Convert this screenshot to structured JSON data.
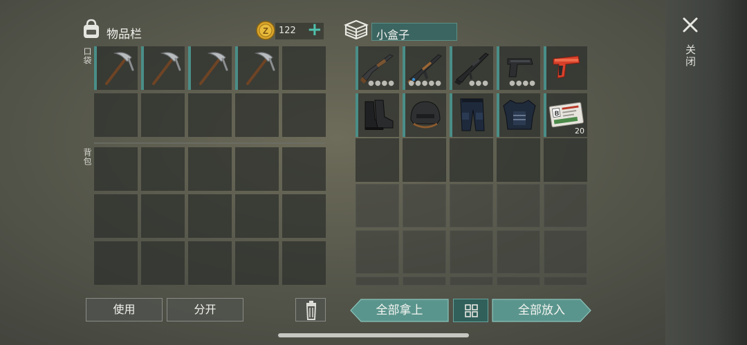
{
  "inventory": {
    "title": "物品栏",
    "coins": "122",
    "pocket_label": "口袋",
    "backpack_label": "背包",
    "pocket_slots": [
      "pickaxe",
      "pickaxe",
      "pickaxe",
      "pickaxe",
      "",
      "",
      "",
      "",
      "",
      ""
    ],
    "backpack_slots": [
      "",
      "",
      "",
      "",
      "",
      "",
      "",
      "",
      "",
      "",
      "",
      "",
      "",
      "",
      "",
      "",
      "",
      "",
      "",
      ""
    ],
    "use_button": "使用",
    "split_button": "分开"
  },
  "container": {
    "name": "小盒子",
    "items": [
      {
        "icon": "shotgun-icon",
        "dots": "●●●●"
      },
      {
        "icon": "assault-rifle-icon",
        "dots": "●●●●●"
      },
      {
        "icon": "m16-rifle-icon",
        "dots": "●●●"
      },
      {
        "icon": "pistol-icon",
        "dots": "●●●●"
      },
      {
        "icon": "flare-gun-icon",
        "dots": ""
      },
      {
        "icon": "boots-icon",
        "dots": ""
      },
      {
        "icon": "helmet-icon",
        "dots": ""
      },
      {
        "icon": "police-pants-icon",
        "dots": ""
      },
      {
        "icon": "police-vest-icon",
        "dots": ""
      },
      {
        "icon": "keycard-icon",
        "qty": "20",
        "card_letter": "B"
      }
    ],
    "take_all_button": "全部拿上",
    "put_all_button": "全部放入"
  },
  "close_label": "关闭",
  "colors": {
    "accent": "#4a8e88",
    "plus": "#4fc1ad",
    "coin": "#d9a42a"
  }
}
